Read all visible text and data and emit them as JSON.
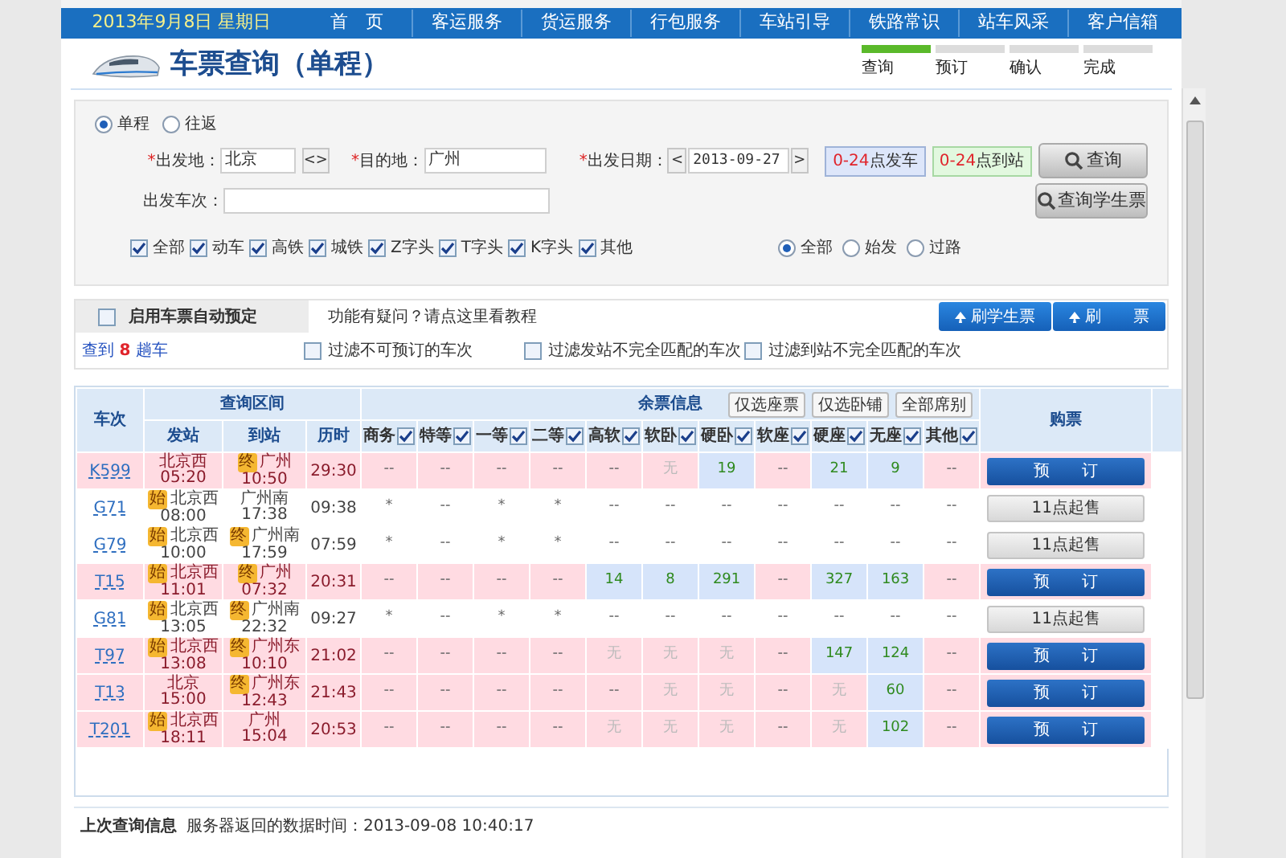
{
  "nav": {
    "date": "2013年9月8日 星期日",
    "items": [
      "首　页",
      "客运服务",
      "货运服务",
      "行包服务",
      "车站引导",
      "铁路常识",
      "站车风采",
      "客户信箱"
    ]
  },
  "page_title": "车票查询（单程）",
  "steps": [
    {
      "label": "查询",
      "done": true
    },
    {
      "label": "预订",
      "done": false
    },
    {
      "label": "确认",
      "done": false
    },
    {
      "label": "完成",
      "done": false
    }
  ],
  "trip_type": [
    {
      "label": "单程",
      "selected": true
    },
    {
      "label": "往返",
      "selected": false
    }
  ],
  "from": {
    "mark": "*",
    "label": "出发地：",
    "value": "北京"
  },
  "swap": "<>",
  "to": {
    "mark": "*",
    "label": "目的地：",
    "value": "广州"
  },
  "date": {
    "mark": "*",
    "label": "出发日期：",
    "prev": "<",
    "value": "2013-09-27",
    "next": ">"
  },
  "depart_time": {
    "range": "0-24",
    "suffix": "点发车"
  },
  "arrive_time": {
    "range": "0-24",
    "suffix": "点到站"
  },
  "search_button": "查询",
  "student_button": "查询学生票",
  "train_no": {
    "label": "出发车次："
  },
  "train_types": [
    {
      "label": "全部",
      "checked": true
    },
    {
      "label": "动车",
      "checked": true
    },
    {
      "label": "高铁",
      "checked": true
    },
    {
      "label": "城铁",
      "checked": true
    },
    {
      "label": "Z字头",
      "checked": true
    },
    {
      "label": "T字头",
      "checked": true
    },
    {
      "label": "K字头",
      "checked": true
    },
    {
      "label": "其他",
      "checked": true
    }
  ],
  "station_types": [
    {
      "label": "全部",
      "selected": true
    },
    {
      "label": "始发",
      "selected": false
    },
    {
      "label": "过路",
      "selected": false
    }
  ],
  "auto_book": {
    "label": "启用车票自动预定",
    "checked": false
  },
  "help_text": "功能有疑问？请点这里看教程",
  "refresh_buttons": [
    "刷学生票",
    "刷　　票"
  ],
  "result": {
    "prefix": "查到",
    "count": "8",
    "suffix": "趟车"
  },
  "filters": [
    {
      "label": "过滤不可预订的车次",
      "checked": false
    },
    {
      "label": "过滤发站不完全匹配的车次",
      "checked": false
    },
    {
      "label": "过滤到站不完全匹配的车次",
      "checked": false
    }
  ],
  "table": {
    "train_header": "车次",
    "range_header": "查询区间",
    "range_columns": [
      "发站",
      "到站",
      "历时"
    ],
    "seat_header": "余票信息",
    "seat_buttons": [
      "仅选座票",
      "仅选卧铺",
      "全部席别"
    ],
    "buy_header": "购票",
    "seat_columns": [
      {
        "label": "商务",
        "checked": true
      },
      {
        "label": "特等",
        "checked": true
      },
      {
        "label": "一等",
        "checked": true
      },
      {
        "label": "二等",
        "checked": true
      },
      {
        "label": "高软",
        "checked": true
      },
      {
        "label": "软卧",
        "checked": true
      },
      {
        "label": "硬卧",
        "checked": true
      },
      {
        "label": "软座",
        "checked": true
      },
      {
        "label": "硬座",
        "checked": true
      },
      {
        "label": "无座",
        "checked": true
      },
      {
        "label": "其他",
        "checked": true
      }
    ],
    "rows": [
      {
        "train": "K599",
        "bookable": true,
        "from_badge": "",
        "from": "北京西",
        "dep": "05:20",
        "to_badge": "终",
        "to": "广州",
        "arr": "10:50",
        "duration": "29:30",
        "seats": [
          {
            "text": "--",
            "kind": "plain"
          },
          {
            "text": "--",
            "kind": "plain"
          },
          {
            "text": "--",
            "kind": "plain"
          },
          {
            "text": "--",
            "kind": "plain"
          },
          {
            "text": "--",
            "kind": "plain"
          },
          {
            "text": "无",
            "kind": "none"
          },
          {
            "text": "19",
            "kind": "avail"
          },
          {
            "text": "--",
            "kind": "plain"
          },
          {
            "text": "21",
            "kind": "avail"
          },
          {
            "text": "9",
            "kind": "avail"
          },
          {
            "text": "--",
            "kind": "plain"
          }
        ],
        "button": {
          "label": "预　　订",
          "kind": "book"
        }
      },
      {
        "train": "G71",
        "bookable": false,
        "from_badge": "始",
        "from": "北京西",
        "dep": "08:00",
        "to_badge": "",
        "to": "广州南",
        "arr": "17:38",
        "duration": "09:38",
        "seats": [
          {
            "text": "*",
            "kind": "plain"
          },
          {
            "text": "--",
            "kind": "plain"
          },
          {
            "text": "*",
            "kind": "plain"
          },
          {
            "text": "*",
            "kind": "plain"
          },
          {
            "text": "--",
            "kind": "plain"
          },
          {
            "text": "--",
            "kind": "plain"
          },
          {
            "text": "--",
            "kind": "plain"
          },
          {
            "text": "--",
            "kind": "plain"
          },
          {
            "text": "--",
            "kind": "plain"
          },
          {
            "text": "--",
            "kind": "plain"
          },
          {
            "text": "--",
            "kind": "plain"
          }
        ],
        "button": {
          "label": "11点起售",
          "kind": "presale"
        }
      },
      {
        "train": "G79",
        "bookable": false,
        "from_badge": "始",
        "from": "北京西",
        "dep": "10:00",
        "to_badge": "终",
        "to": "广州南",
        "arr": "17:59",
        "duration": "07:59",
        "seats": [
          {
            "text": "*",
            "kind": "plain"
          },
          {
            "text": "--",
            "kind": "plain"
          },
          {
            "text": "*",
            "kind": "plain"
          },
          {
            "text": "*",
            "kind": "plain"
          },
          {
            "text": "--",
            "kind": "plain"
          },
          {
            "text": "--",
            "kind": "plain"
          },
          {
            "text": "--",
            "kind": "plain"
          },
          {
            "text": "--",
            "kind": "plain"
          },
          {
            "text": "--",
            "kind": "plain"
          },
          {
            "text": "--",
            "kind": "plain"
          },
          {
            "text": "--",
            "kind": "plain"
          }
        ],
        "button": {
          "label": "11点起售",
          "kind": "presale"
        }
      },
      {
        "train": "T15",
        "bookable": true,
        "from_badge": "始",
        "from": "北京西",
        "dep": "11:01",
        "to_badge": "终",
        "to": "广州",
        "arr": "07:32",
        "duration": "20:31",
        "seats": [
          {
            "text": "--",
            "kind": "plain"
          },
          {
            "text": "--",
            "kind": "plain"
          },
          {
            "text": "--",
            "kind": "plain"
          },
          {
            "text": "--",
            "kind": "plain"
          },
          {
            "text": "14",
            "kind": "avail"
          },
          {
            "text": "8",
            "kind": "avail"
          },
          {
            "text": "291",
            "kind": "avail"
          },
          {
            "text": "--",
            "kind": "plain"
          },
          {
            "text": "327",
            "kind": "avail"
          },
          {
            "text": "163",
            "kind": "avail"
          },
          {
            "text": "--",
            "kind": "plain"
          }
        ],
        "button": {
          "label": "预　　订",
          "kind": "book"
        }
      },
      {
        "train": "G81",
        "bookable": false,
        "from_badge": "始",
        "from": "北京西",
        "dep": "13:05",
        "to_badge": "终",
        "to": "广州南",
        "arr": "22:32",
        "duration": "09:27",
        "seats": [
          {
            "text": "*",
            "kind": "plain"
          },
          {
            "text": "--",
            "kind": "plain"
          },
          {
            "text": "*",
            "kind": "plain"
          },
          {
            "text": "*",
            "kind": "plain"
          },
          {
            "text": "--",
            "kind": "plain"
          },
          {
            "text": "--",
            "kind": "plain"
          },
          {
            "text": "--",
            "kind": "plain"
          },
          {
            "text": "--",
            "kind": "plain"
          },
          {
            "text": "--",
            "kind": "plain"
          },
          {
            "text": "--",
            "kind": "plain"
          },
          {
            "text": "--",
            "kind": "plain"
          }
        ],
        "button": {
          "label": "11点起售",
          "kind": "presale"
        }
      },
      {
        "train": "T97",
        "bookable": true,
        "from_badge": "始",
        "from": "北京西",
        "dep": "13:08",
        "to_badge": "终",
        "to": "广州东",
        "arr": "10:10",
        "duration": "21:02",
        "seats": [
          {
            "text": "--",
            "kind": "plain"
          },
          {
            "text": "--",
            "kind": "plain"
          },
          {
            "text": "--",
            "kind": "plain"
          },
          {
            "text": "--",
            "kind": "plain"
          },
          {
            "text": "无",
            "kind": "none"
          },
          {
            "text": "无",
            "kind": "none"
          },
          {
            "text": "无",
            "kind": "none"
          },
          {
            "text": "--",
            "kind": "plain"
          },
          {
            "text": "147",
            "kind": "avail"
          },
          {
            "text": "124",
            "kind": "avail"
          },
          {
            "text": "--",
            "kind": "plain"
          }
        ],
        "button": {
          "label": "预　　订",
          "kind": "book"
        }
      },
      {
        "train": "T13",
        "bookable": true,
        "from_badge": "",
        "from": "北京",
        "dep": "15:00",
        "to_badge": "终",
        "to": "广州东",
        "arr": "12:43",
        "duration": "21:43",
        "seats": [
          {
            "text": "--",
            "kind": "plain"
          },
          {
            "text": "--",
            "kind": "plain"
          },
          {
            "text": "--",
            "kind": "plain"
          },
          {
            "text": "--",
            "kind": "plain"
          },
          {
            "text": "--",
            "kind": "plain"
          },
          {
            "text": "无",
            "kind": "none"
          },
          {
            "text": "无",
            "kind": "none"
          },
          {
            "text": "--",
            "kind": "plain"
          },
          {
            "text": "无",
            "kind": "none"
          },
          {
            "text": "60",
            "kind": "avail"
          },
          {
            "text": "--",
            "kind": "plain"
          }
        ],
        "button": {
          "label": "预　　订",
          "kind": "book"
        }
      },
      {
        "train": "T201",
        "bookable": true,
        "from_badge": "始",
        "from": "北京西",
        "dep": "18:11",
        "to_badge": "",
        "to": "广州",
        "arr": "15:04",
        "duration": "20:53",
        "seats": [
          {
            "text": "--",
            "kind": "plain"
          },
          {
            "text": "--",
            "kind": "plain"
          },
          {
            "text": "--",
            "kind": "plain"
          },
          {
            "text": "--",
            "kind": "plain"
          },
          {
            "text": "无",
            "kind": "none"
          },
          {
            "text": "无",
            "kind": "none"
          },
          {
            "text": "无",
            "kind": "none"
          },
          {
            "text": "--",
            "kind": "plain"
          },
          {
            "text": "无",
            "kind": "none"
          },
          {
            "text": "102",
            "kind": "avail"
          },
          {
            "text": "--",
            "kind": "plain"
          }
        ],
        "button": {
          "label": "预　　订",
          "kind": "book"
        }
      }
    ]
  },
  "footer": {
    "title": "上次查询信息",
    "text": "服务器返回的数据时间：2013-09-08 10:40:17"
  }
}
